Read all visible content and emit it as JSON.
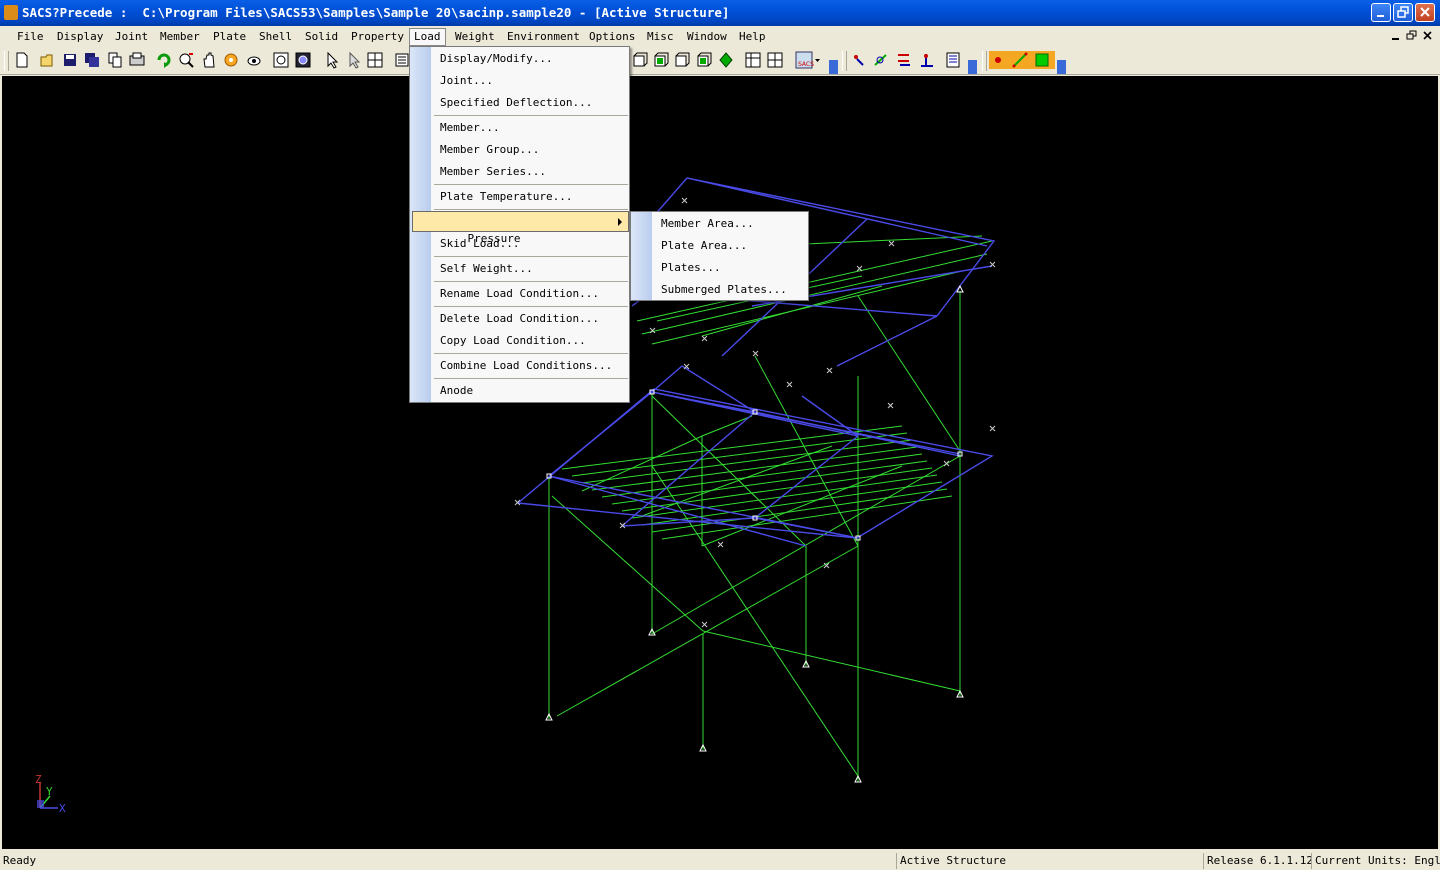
{
  "window": {
    "title": "SACS?Precede :  C:\\Program Files\\SACS53\\Samples\\Sample 20\\sacinp.sample20 - [Active Structure]"
  },
  "menubar": {
    "items": [
      "File",
      "Display",
      "Joint",
      "Member",
      "Plate",
      "Shell",
      "Solid",
      "Property",
      "Load",
      "Weight",
      "Environment",
      "Options",
      "Misc",
      "Window",
      "Help"
    ],
    "active": "Load"
  },
  "load_menu": {
    "items": [
      {
        "label": "Display/Modify..."
      },
      {
        "label": "Joint..."
      },
      {
        "label": "Specified Deflection..."
      },
      {
        "label": "Member..."
      },
      {
        "label": "Member Group..."
      },
      {
        "label": "Member Series..."
      },
      {
        "label": "Plate Temperature..."
      },
      {
        "label": "Pressure"
      },
      {
        "label": "Skid Load..."
      },
      {
        "label": "Self Weight..."
      },
      {
        "label": "Rename Load Condition..."
      },
      {
        "label": "Delete Load Condition..."
      },
      {
        "label": "Copy Load Condition..."
      },
      {
        "label": "Combine Load Conditions..."
      },
      {
        "label": "Anode"
      }
    ],
    "highlighted": "Pressure"
  },
  "pressure_submenu": {
    "items": [
      {
        "label": "Member Area..."
      },
      {
        "label": "Plate Area..."
      },
      {
        "label": "Plates..."
      },
      {
        "label": "Submerged Plates..."
      }
    ]
  },
  "axis_triad": {
    "z": "Z",
    "y": "Y",
    "x": "X"
  },
  "statusbar": {
    "ready": "Ready",
    "structure": "Active Structure",
    "release": "Release 6.1.1.12",
    "units": "Current Units: English"
  },
  "colors": {
    "viewport_bg": "#000000",
    "members_green": "#33dd33",
    "members_blue": "#4a4ae8",
    "menu_highlight": "#ffe9a9",
    "titlebar": "#0050d8"
  },
  "toolbar": {
    "icons": [
      "new-file-icon",
      "open-folder-icon",
      "save-icon",
      "save-all-icon",
      "copy-icon",
      "paste-icon",
      "print-icon",
      "refresh-icon",
      "zoom-icon",
      "pan-hand-icon",
      "rotate-icon",
      "view-icon",
      "zoom-window-icon",
      "zoom-extent-icon",
      "select-arrow-icon",
      "select-add-icon",
      "grid-icon",
      "list-icon",
      "view-iso-icon",
      "view-front-icon",
      "view-side-icon",
      "view-top-icon",
      "view-3d-icon",
      "table-icon",
      "report-icon",
      "sacs-icon",
      "joint-label-icon",
      "member-label-icon",
      "offset-icon",
      "releases-icon",
      "legend-icon",
      "point-icon",
      "line-icon",
      "area-icon"
    ]
  }
}
